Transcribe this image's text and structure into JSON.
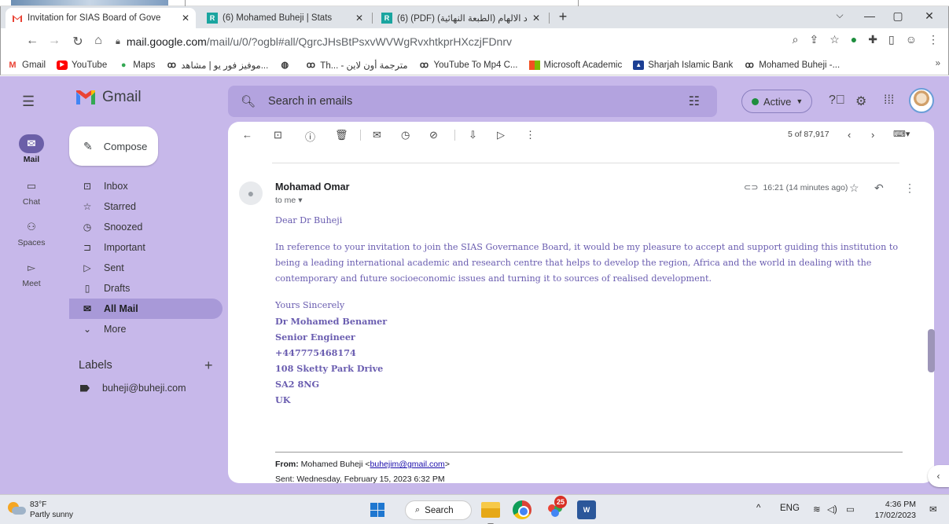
{
  "browser": {
    "tabs": [
      {
        "label": "Invitation for SIAS Board of Gove",
        "icon": "gmail-icon",
        "active": true
      },
      {
        "label": "(6) Mohamed Buheji | Stats",
        "icon": "researchgate-icon",
        "active": false
      },
      {
        "label": "(6) (PDF) (الطبعة النهائية) اد الالهام",
        "icon": "researchgate-icon",
        "active": false
      }
    ],
    "new_tab": "+",
    "window_controls": {
      "minimize": "—",
      "restore": "▢",
      "close": "✕"
    },
    "url_host": "mail.google.com",
    "url_path": "/mail/u/0/?ogbl#all/QgrcJHsBtPsxvWVWgRvxhtkprHXczjFDnrv",
    "bookmarks": [
      {
        "label": "Gmail",
        "icon": "gmail-icon"
      },
      {
        "label": "YouTube",
        "icon": "youtube-icon"
      },
      {
        "label": "Maps",
        "icon": "maps-icon"
      },
      {
        "label": "موفيز فور يو | مشاهد...",
        "icon": "site-icon"
      },
      {
        "label": "",
        "icon": "globe-icon"
      },
      {
        "label": "Th... - مترجمة أون لاين",
        "icon": "site-icon"
      },
      {
        "label": "YouTube To Mp4 C...",
        "icon": "site-icon"
      },
      {
        "label": "Microsoft Academic",
        "icon": "microsoft-icon"
      },
      {
        "label": "Sharjah Islamic Bank",
        "icon": "bank-icon"
      },
      {
        "label": "Mohamed Buheji -...",
        "icon": "site-icon"
      }
    ],
    "bookmarks_more": "»"
  },
  "gmail": {
    "logo_text": "Gmail",
    "search_placeholder": "Search in emails",
    "status": "Active",
    "rail": [
      {
        "label": "Mail",
        "icon": "mail-icon",
        "active": true
      },
      {
        "label": "Chat",
        "icon": "chat-icon",
        "active": false
      },
      {
        "label": "Spaces",
        "icon": "spaces-icon",
        "active": false
      },
      {
        "label": "Meet",
        "icon": "meet-icon",
        "active": false
      }
    ],
    "compose_label": "Compose",
    "nav": [
      {
        "label": "Inbox",
        "icon": "inbox-icon",
        "selected": false
      },
      {
        "label": "Starred",
        "icon": "star-icon",
        "selected": false
      },
      {
        "label": "Snoozed",
        "icon": "clock-icon",
        "selected": false
      },
      {
        "label": "Important",
        "icon": "important-icon",
        "selected": false
      },
      {
        "label": "Sent",
        "icon": "send-icon",
        "selected": false
      },
      {
        "label": "Drafts",
        "icon": "draft-icon",
        "selected": false
      },
      {
        "label": "All Mail",
        "icon": "all-mail-icon",
        "selected": true
      },
      {
        "label": "More",
        "icon": "chevron-down-icon",
        "selected": false
      }
    ],
    "labels_title": "Labels",
    "labels": [
      "buheji@buheji.com"
    ],
    "pager": "5 of 87,917"
  },
  "email": {
    "sender": "Mohamad Omar",
    "to": "to me",
    "time": "16:21 (14 minutes ago)",
    "greeting": "Dear Dr Buheji",
    "body": "In reference to your invitation to join the SIAS Governance Board, it would be my pleasure to accept and support guiding this institution to being a leading international academic and research centre that helps to develop the region, Africa and the world in dealing with the contemporary and future socioeconomic issues and turning it to sources of realised development.",
    "closing": "Yours Sincerely",
    "signature": [
      "Dr Mohamed Benamer",
      "Senior Engineer",
      "+447775468174",
      "108 Sketty Park Drive",
      "SA2 8NG",
      "UK"
    ],
    "from_label": "From:",
    "from_name": "Mohamed Buheji",
    "from_email": "buhejim@gmail.com",
    "sent_line": "Sent: Wednesday, February 15, 2023 6:32 PM"
  },
  "taskbar": {
    "temperature": "83°F",
    "weather": "Partly sunny",
    "search": "Search",
    "badge_count": "25",
    "tray_chevron": "^",
    "language": "ENG",
    "time": "4:36 PM",
    "date": "17/02/2023"
  }
}
